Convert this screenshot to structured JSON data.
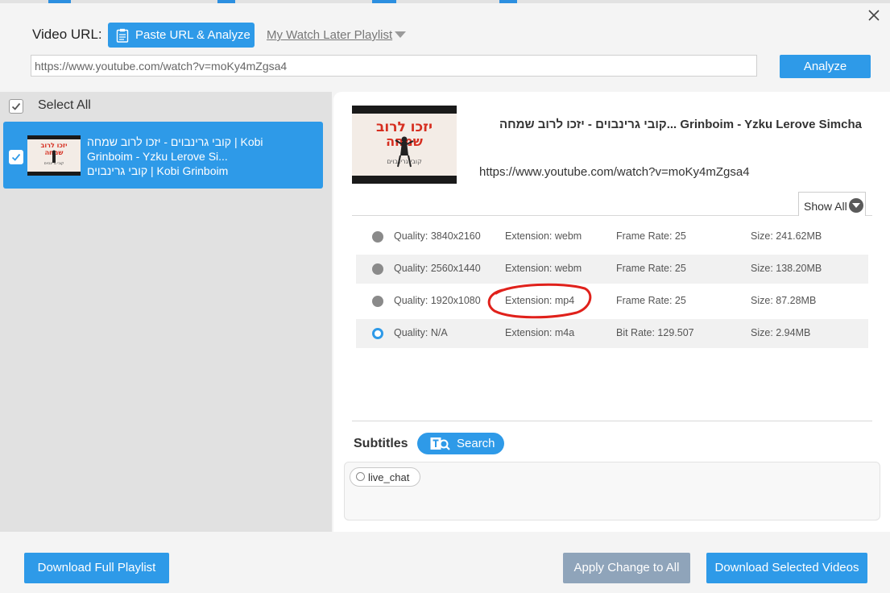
{
  "header": {
    "video_url_label": "Video URL:",
    "paste_button": "Paste URL & Analyze",
    "watch_later_link": "My Watch Later Playlist",
    "url_value": "https://www.youtube.com/watch?v=moKy4mZgsa4",
    "analyze_button": "Analyze"
  },
  "sidebar": {
    "select_all_label": "Select All",
    "select_all_checked": true,
    "items": [
      {
        "checked": true,
        "title_line1": "קובי גרינבוים - יזכו לרוב שמחה | Kobi",
        "title_line2": "Grinboim - Yzku Lerove Si...",
        "title_line3": "קובי גרינבוים | Kobi Grinboim"
      }
    ]
  },
  "detail": {
    "title": "קובי גרינבוים - יזכו לרוב שמחה... Grinboim - Yzku Lerove Simcha",
    "url": "https://www.youtube.com/watch?v=moKy4mZgsa4",
    "thumbnail_text_top": "יזכו לרוב",
    "thumbnail_text_mid": "שמחה",
    "thumbnail_text_bottom": "קובי גרינבוים",
    "show_all": "Show All",
    "formats": [
      {
        "quality": "Quality: 3840x2160",
        "extension": "Extension: webm",
        "rate": "Frame Rate: 25",
        "size": "Size: 241.62MB",
        "selected": false
      },
      {
        "quality": "Quality: 2560x1440",
        "extension": "Extension: webm",
        "rate": "Frame Rate: 25",
        "size": "Size: 138.20MB",
        "selected": false
      },
      {
        "quality": "Quality: 1920x1080",
        "extension": "Extension: mp4",
        "rate": "Frame Rate: 25",
        "size": "Size: 87.28MB",
        "selected": false
      },
      {
        "quality": "Quality: N/A",
        "extension": "Extension: m4a",
        "rate": "Bit Rate: 129.507",
        "size": "Size: 2.94MB",
        "selected": true
      }
    ],
    "subtitles_label": "Subtitles",
    "search_button": "Search",
    "subtitle_options": [
      "live_chat"
    ]
  },
  "footer": {
    "download_playlist": "Download Full Playlist",
    "apply_change": "Apply Change to All",
    "download_selected": "Download Selected Videos"
  },
  "colors": {
    "accent": "#2e9ae8",
    "annotation": "#e0211b",
    "apply_button": "#8fa4ba"
  }
}
